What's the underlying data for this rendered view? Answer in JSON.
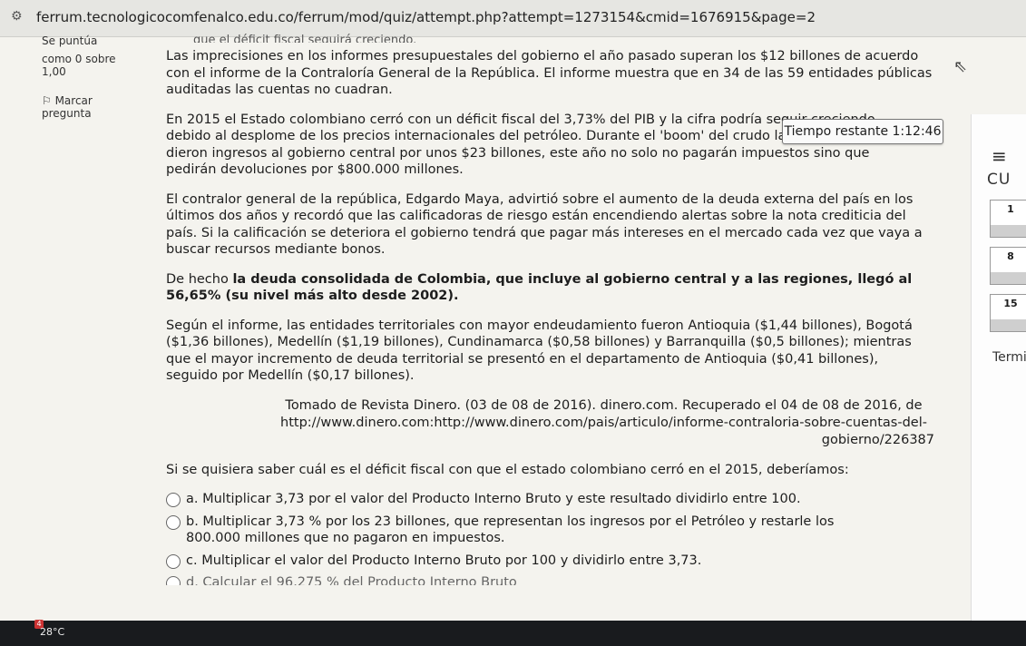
{
  "browser": {
    "url": "ferrum.tecnologicocomfenalco.edu.co/ferrum/mod/quiz/attempt.php?attempt=1273154&cmid=1676915&page=2"
  },
  "question_info": {
    "scored_label": "Se puntúa",
    "scored_value": "como 0 sobre",
    "max_score": "1,00",
    "flag_label": "Marcar",
    "flag_label2": "pregunta"
  },
  "timer": {
    "label": "Tiempo restante 1:12:46"
  },
  "passage": {
    "cut_top": "que el déficit fiscal seguirá creciendo.",
    "p1": "Las imprecisiones en los informes presupuestales del gobierno el año pasado superan los $12 billones de acuerdo con el informe de la Contraloría General de la República. El informe muestra que en 34 de las 59 entidades públicas auditadas las cuentas no cuadran.",
    "p2": "En 2015 el Estado colombiano cerró con un déficit fiscal del 3,73% del PIB y la cifra podría seguir creciendo debido al desplome de los precios internacionales del petróleo. Durante el 'boom' del crudo las petroleras le dieron ingresos al gobierno central por unos $23 billones, este año no solo no pagarán impuestos sino que pedirán devoluciones por $800.000 millones.",
    "p3": "El contralor general de la república, Edgardo Maya, advirtió sobre el aumento de la deuda externa del país en los últimos dos años y recordó que las calificadoras de riesgo están encendiendo alertas sobre la nota crediticia del país. Si la calificación se deteriora el gobierno tendrá que pagar más intereses en el mercado cada vez que vaya a buscar recursos mediante bonos.",
    "p4_start": "De hecho ",
    "p4_bold": "la deuda consolidada de Colombia, que incluye al gobierno central y a las regiones, llegó al 56,65% (su nivel más alto desde 2002).",
    "p5": "Según el informe, las entidades territoriales con mayor endeudamiento fueron Antioquia ($1,44 billones), Bogotá ($1,36 billones), Medellín ($1,19 billones), Cundinamarca ($0,58 billones) y Barranquilla ($0,5 billones); mientras que el mayor incremento de deuda territorial se presentó en el departamento de Antioquia ($0,41 billones), seguido por Medellín ($0,17 billones).",
    "ref_line1": "Tomado de Revista Dinero. (03 de 08 de 2016). dinero.com. Recuperado el 04 de 08 de 2016, de",
    "ref_line2": "http://www.dinero.com:http://www.dinero.com/pais/articulo/informe-contraloria-sobre-cuentas-del-",
    "ref_line3": "gobierno/226387"
  },
  "question": {
    "prompt": "Si se quisiera saber cuál es el déficit fiscal con que el estado colombiano cerró en el 2015, deberíamos:",
    "options": [
      {
        "text": "a. Multiplicar 3,73 por el valor del Producto Interno Bruto y este resultado dividirlo entre 100."
      },
      {
        "text": "b. Multiplicar 3,73 % por los 23 billones, que representan los ingresos por el Petróleo y restarle los 800.000 millones que no pagaron en impuestos."
      },
      {
        "text": "c. Multiplicar el valor del Producto Interno Bruto por 100 y dividirlo entre 3,73."
      },
      {
        "text": "d. Calcular el 96,275 % del Producto Interno Bruto"
      }
    ]
  },
  "nav_panel": {
    "title": "CU",
    "q1": "1",
    "q8": "8",
    "q15": "15",
    "finish": "Termi"
  },
  "taskbar": {
    "badge": "4",
    "weather": "28°C"
  }
}
